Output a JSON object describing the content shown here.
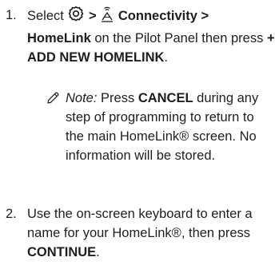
{
  "steps": [
    {
      "number": "1.",
      "text_select": "Select",
      "sep1": ">",
      "connectivity": "Connectivity",
      "sep2": ">",
      "homelink": "HomeLink",
      "text_on_panel": "on the Pilot Panel then press",
      "add_new": "+ ADD NEW HOMELINK",
      "period": "."
    },
    {
      "number": "2.",
      "text_a": "Use the on-screen keyboard to enter a name for your HomeLink®, then press",
      "continue": "CONTINUE",
      "period": "."
    }
  ],
  "note": {
    "label": "Note:",
    "text_a": "Press",
    "cancel": "CANCEL",
    "text_b": "during any step of programming to return to the main HomeLink® screen. No information will be stored."
  },
  "icons": {
    "settings": "gear-icon",
    "connectivity": "connectivity-icon",
    "note": "pencil-icon"
  }
}
